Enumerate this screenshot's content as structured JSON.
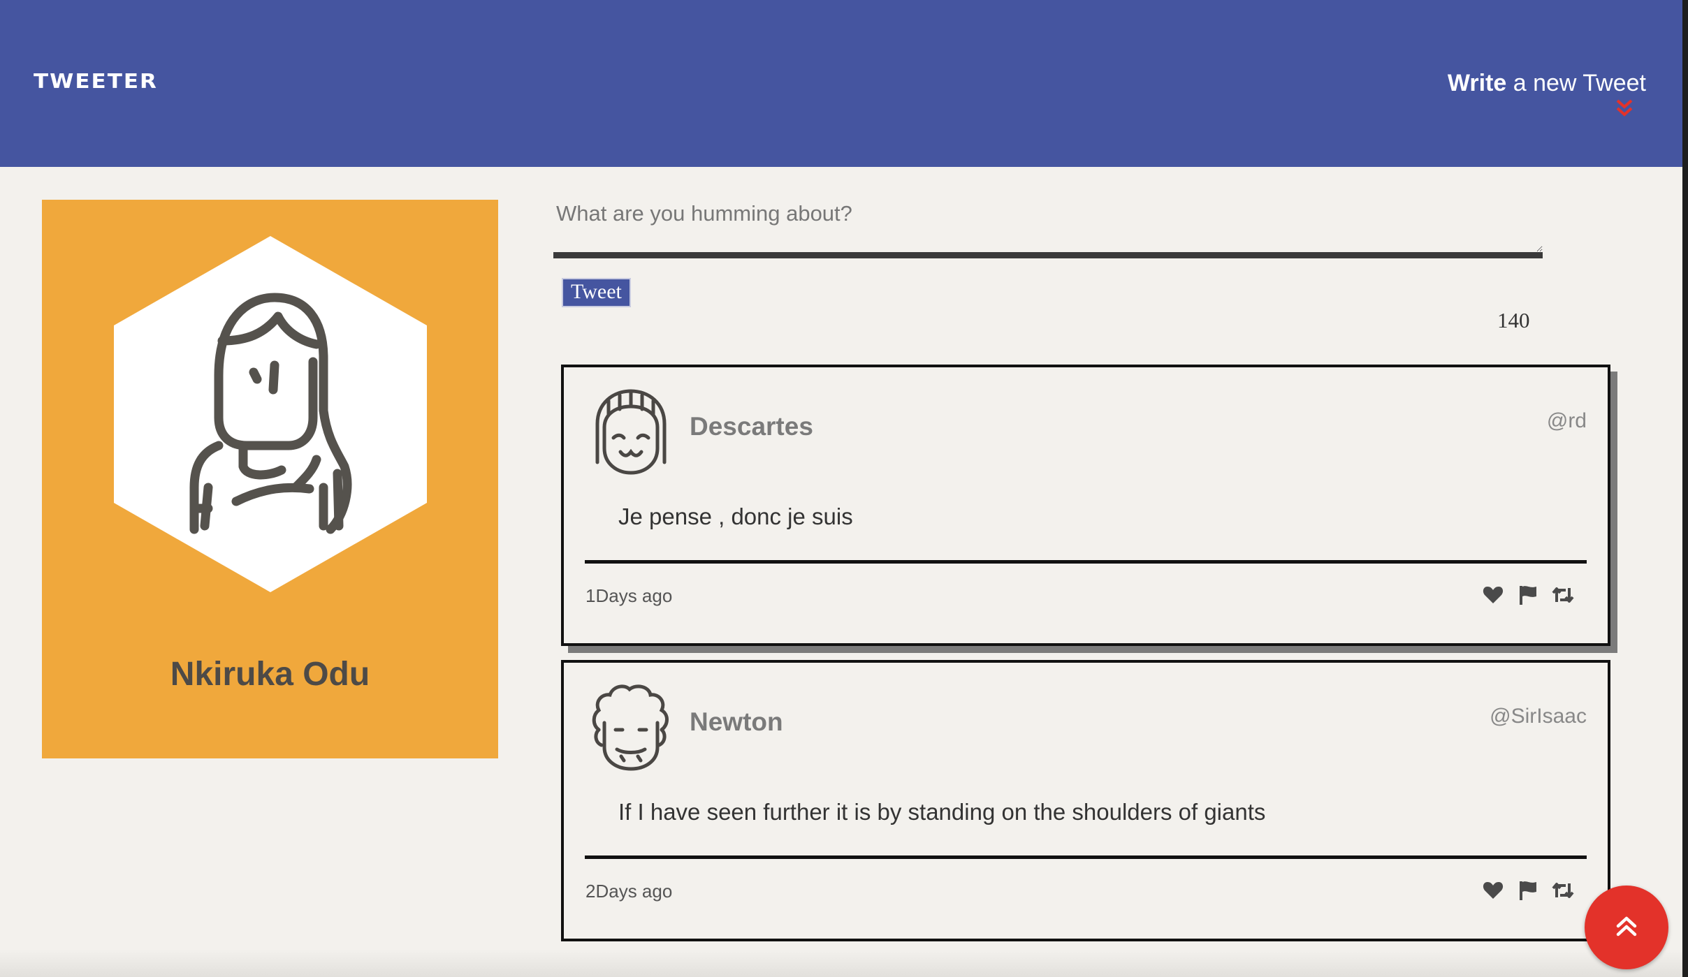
{
  "nav": {
    "brand": "TWEETER",
    "compose_bold": "Write",
    "compose_rest": " a new Tweet"
  },
  "profile": {
    "name": "Nkiruka Odu"
  },
  "composer": {
    "placeholder": "What are you humming about?",
    "button_label": "Tweet",
    "char_count": "140"
  },
  "tweets": [
    {
      "author": "Descartes",
      "handle": "@rd",
      "content": "Je pense , donc je suis",
      "time": "1Days ago"
    },
    {
      "author": "Newton",
      "handle": "@SirIsaac",
      "content": "If I have seen further it is by standing on the shoulders of giants",
      "time": "2Days ago"
    }
  ],
  "icons": [
    "double-chevron-down-icon",
    "heart-icon",
    "flag-icon",
    "retweet-icon",
    "double-chevron-up-icon"
  ],
  "colors": {
    "nav": "#4555a0",
    "profile_card": "#f0a83c",
    "scroll_button": "#e3322a",
    "background": "#f3f1ed"
  }
}
